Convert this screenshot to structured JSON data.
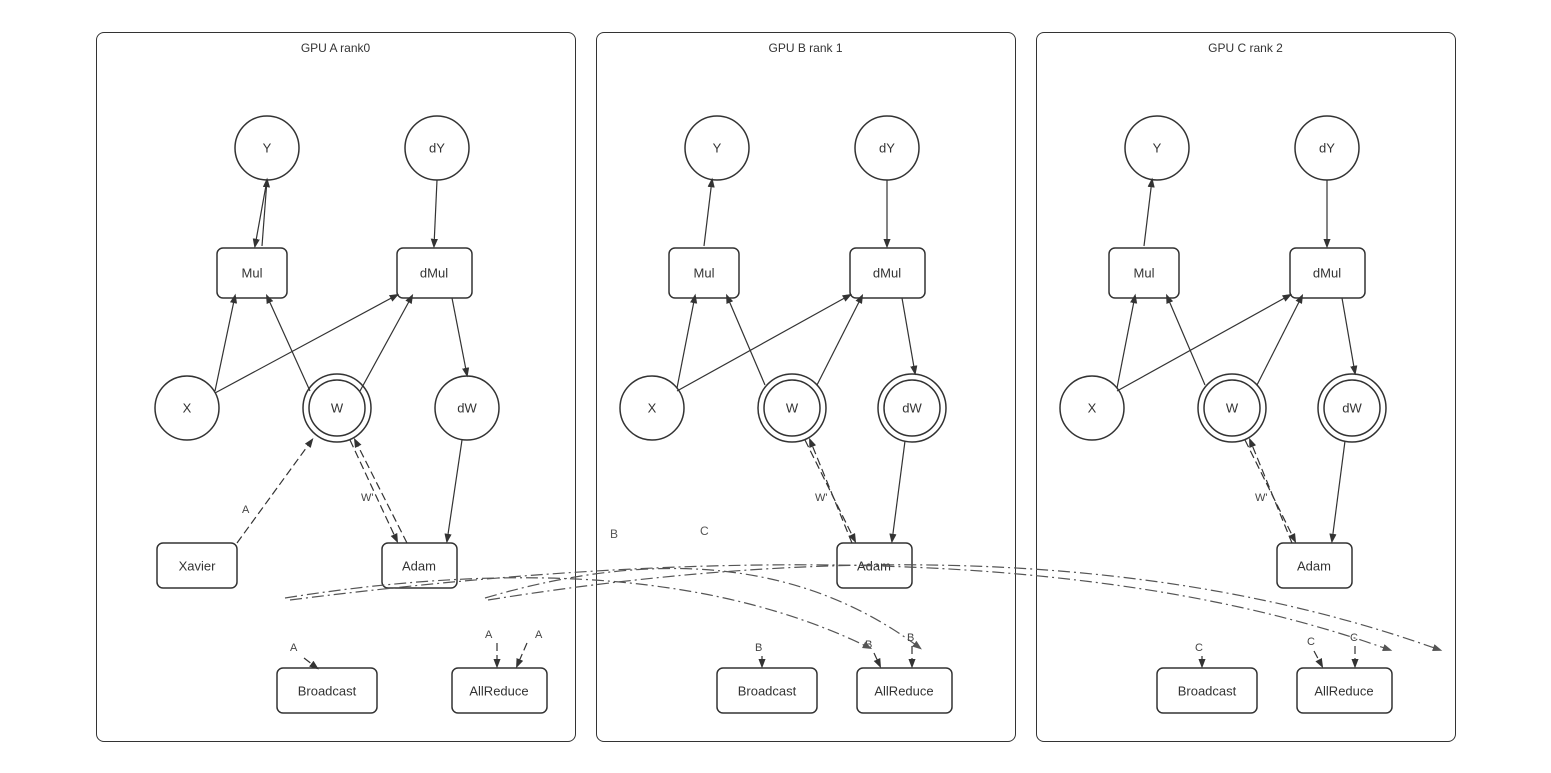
{
  "gpus": [
    {
      "id": "gpu-a",
      "title": "GPU A rank0"
    },
    {
      "id": "gpu-b",
      "title": "GPU B rank 1"
    },
    {
      "id": "gpu-c",
      "title": "GPU C rank 2"
    }
  ],
  "nodes": {
    "Y": "Y",
    "dY": "dY",
    "Mul": "Mul",
    "dMul": "dMul",
    "X": "X",
    "W": "W",
    "dW": "dW",
    "Xavier": "Xavier",
    "Adam": "Adam",
    "Broadcast": "Broadcast",
    "AllReduce": "AllReduce"
  }
}
